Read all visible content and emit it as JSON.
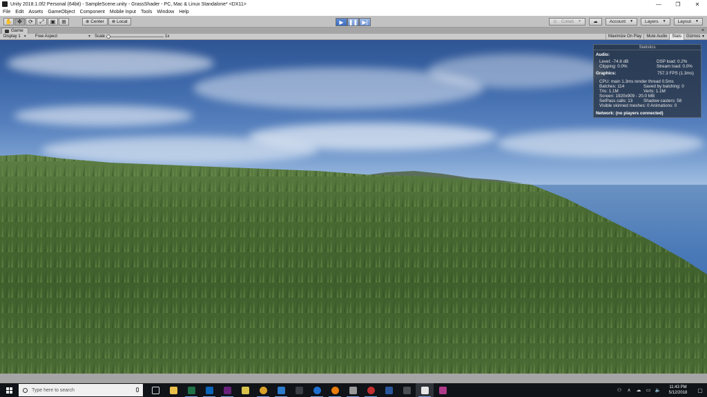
{
  "window": {
    "title": "Unity 2018.1.0f2 Personal (64bit) - SampleScene.unity - GrassShader - PC, Mac & Linux Standalone* <DX11>",
    "minimize": "—",
    "maximize": "❐",
    "close": "✕"
  },
  "menu": [
    "File",
    "Edit",
    "Assets",
    "GameObject",
    "Component",
    "Mobile Input",
    "Tools",
    "Window",
    "Help"
  ],
  "toolbar": {
    "tools": [
      "hand-icon",
      "move-icon",
      "rotate-icon",
      "scale-icon",
      "rect-icon",
      "transform-icon"
    ],
    "pivot": "Center",
    "space": "Local",
    "collab": "Collab",
    "account": "Account",
    "layers": "Layers",
    "layout": "Layout"
  },
  "game": {
    "tab": "Game",
    "display": "Display 1",
    "aspect": "Free Aspect",
    "scale_label": "Scale",
    "scale_value": "1x",
    "maximize_on_play": "Maximize On Play",
    "mute_audio": "Mute Audio",
    "stats": "Stats",
    "gizmos": "Gizmos"
  },
  "stats": {
    "header": "Statistics",
    "audio": "Audio:",
    "level": "Level: -74.8 dB",
    "dsp": "DSP load: 0.2%",
    "clipping": "Clipping: 0.0%",
    "stream": "Stream load: 0.0%",
    "graphics": "Graphics:",
    "fps": "757.3 FPS (1.3ms)",
    "cpu": "CPU: main 1.3ms  render thread 0.5ms",
    "batches": "Batches: 114",
    "saved": "Saved by batching: 0",
    "tris": "Tris: 1.1M",
    "verts": "Verts: 1.1M",
    "screen": "Screen: 1920x909 - 20.0 MB",
    "setpass": "SetPass calls: 13",
    "shadow": "Shadow casters: 58",
    "skinned": "Visible skinned meshes: 0  Animations: 0",
    "network": "Network: (no players connected)"
  },
  "taskbar": {
    "search_placeholder": "Type here to search",
    "time": "11:43 PM",
    "date": "5/12/2018"
  }
}
